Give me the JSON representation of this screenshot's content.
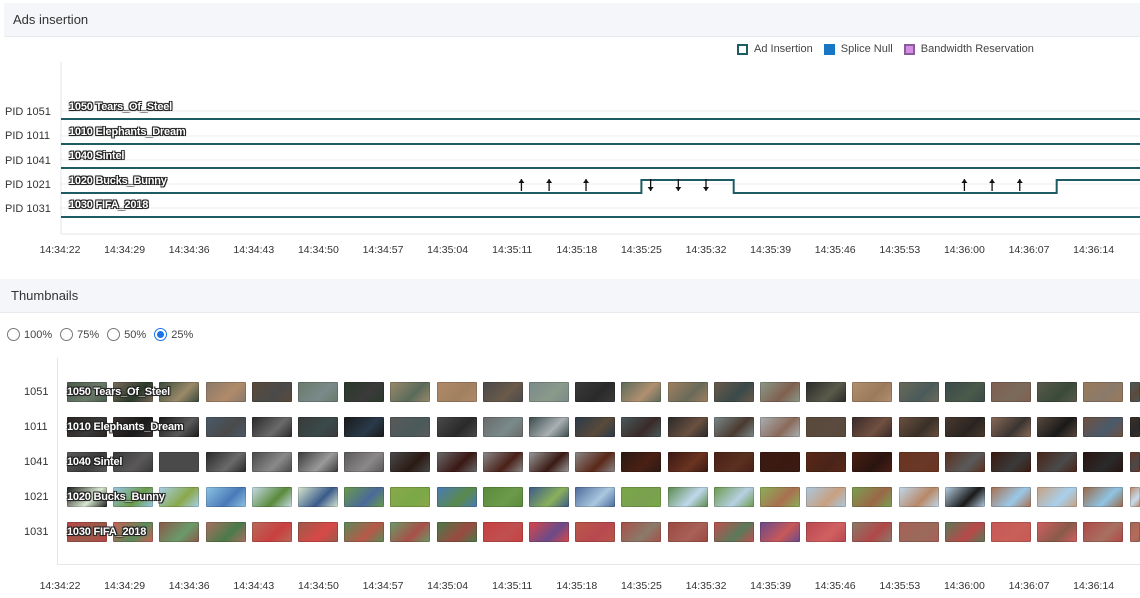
{
  "ads": {
    "title": "Ads insertion",
    "legend": [
      {
        "label": "Ad Insertion",
        "color": "#ffffff",
        "border": "#1d5c63"
      },
      {
        "label": "Splice Null",
        "color": "#1777c4",
        "border": "#1777c4"
      },
      {
        "label": "Bandwidth Reservation",
        "color": "#d48ee6",
        "border": "#8a5c99"
      }
    ],
    "line_color": "#1d5c63",
    "rows": [
      {
        "pid": "PID 1051",
        "stream": "1050 Tears_Of_Steel"
      },
      {
        "pid": "PID 1011",
        "stream": "1010 Elephants_Dream"
      },
      {
        "pid": "PID 1041",
        "stream": "1040 Sintel"
      },
      {
        "pid": "PID 1021",
        "stream": "1020 Bucks_Bunny"
      },
      {
        "pid": "PID 1031",
        "stream": "1030 FIFA_2018"
      }
    ],
    "events": {
      "up_arrows_1": [
        "14:35:12",
        "14:35:15",
        "14:35:19"
      ],
      "down_arrows": [
        "14:35:26",
        "14:35:29",
        "14:35:32"
      ],
      "up_arrows_2": [
        "14:36:00",
        "14:36:03",
        "14:36:06"
      ],
      "ad_block_1": {
        "start": "14:35:25",
        "end": "14:35:35"
      },
      "ad_block_2": {
        "start": "14:36:10",
        "end": "end"
      }
    },
    "time_ticks": [
      "14:34:22",
      "14:34:29",
      "14:34:36",
      "14:34:43",
      "14:34:50",
      "14:34:57",
      "14:35:04",
      "14:35:11",
      "14:35:18",
      "14:35:25",
      "14:35:32",
      "14:35:39",
      "14:35:46",
      "14:35:53",
      "14:36:00",
      "14:36:07",
      "14:36:14"
    ]
  },
  "thumbnails": {
    "title": "Thumbnails",
    "zoom_options": [
      {
        "label": "100%",
        "checked": false
      },
      {
        "label": "75%",
        "checked": false
      },
      {
        "label": "50%",
        "checked": false
      },
      {
        "label": "25%",
        "checked": true
      }
    ],
    "rows": [
      {
        "pid": "1051",
        "stream": "1050 Tears_Of_Steel",
        "palette": [
          "#4a5a4a",
          "#7a6a5a",
          "#3a4a3a",
          "#8a7a6a",
          "#5a4a3a",
          "#6a7a6a",
          "#2a3a2a",
          "#9a8a6a",
          "#b08a6a",
          "#4a4a4a",
          "#7a8a8a",
          "#3a3a3a",
          "#5a6a5a",
          "#a08060",
          "#6a5a4a",
          "#8a9a8a",
          "#2a2a2a",
          "#b09070",
          "#6a6a5a",
          "#3a4a4a",
          "#806050",
          "#5a5a4a",
          "#9a7a5a",
          "#4a5a5a"
        ]
      },
      {
        "pid": "1011",
        "stream": "1010 Elephants_Dream",
        "palette": [
          "#2a2420",
          "#3a3430",
          "#1a1a1a",
          "#4a5a6a",
          "#2a2a2a",
          "#3a3a3a",
          "#1a1a1a",
          "#5a5a5a",
          "#4a4a4a",
          "#6a6a6a",
          "#3a4a4a",
          "#2a3a4a",
          "#4a5a5a",
          "#2a2a2a",
          "#7a8a8a",
          "#aab0b4",
          "#5a4a3a",
          "#3a2a2a",
          "#6a5040",
          "#4a3a30",
          "#8a6a5a",
          "#5a4a40",
          "#705040",
          "#3a3028"
        ]
      },
      {
        "pid": "1041",
        "stream": "1040 Sintel",
        "palette": [
          "#5a5a5a",
          "#3a3a3a",
          "#4a4a4a",
          "#2a2a2a",
          "#4a4848",
          "#3a3a3a",
          "#5a5858",
          "#4a4a4a",
          "#6a6a6a",
          "#8a8a8a",
          "#9a9a9a",
          "#8a8888",
          "#2a1a14",
          "#3a1814",
          "#4a2018",
          "#3a1a14",
          "#5a2818",
          "#4a2014",
          "#6a3420",
          "#5a3020",
          "#3a1a10",
          "#4a2418",
          "#2a1410",
          "#6a3828"
        ]
      },
      {
        "pid": "1021",
        "stream": "1020 Bucks_Bunny",
        "palette": [
          "#1a1a1a",
          "#9ac8e8",
          "#a8d0ec",
          "#8ec4e4",
          "#c8dcec",
          "#d8e8d0",
          "#6a9a4a",
          "#8aa84a",
          "#4a7ab8",
          "#5a8a3a",
          "#3a5a8a",
          "#4a6a9a",
          "#7aa848",
          "#5a8a4a",
          "#6a9a4a",
          "#8ab05a",
          "#aac8e0",
          "#7aa050",
          "#c0d8ec",
          "#b8d0e4",
          "#a87050",
          "#c8a080",
          "#9a6848",
          "#b88868"
        ]
      },
      {
        "pid": "1031",
        "stream": "1030 FIFA_2018",
        "palette": [
          "#b84848",
          "#c86058",
          "#8a5a4a",
          "#a87060",
          "#b86a5a",
          "#9a5a4a",
          "#5a8a5a",
          "#6a9a6a",
          "#4a7a4a",
          "#c84040",
          "#d84848",
          "#b85848",
          "#a85048",
          "#9a4a40",
          "#c05050",
          "#6a4a8a",
          "#b84850",
          "#8a7a6a",
          "#a86058",
          "#5a7a5a",
          "#c85858",
          "#d06060",
          "#b04848",
          "#9a6a5a"
        ]
      }
    ],
    "time_ticks": [
      "14:34:22",
      "14:34:29",
      "14:34:36",
      "14:34:43",
      "14:34:50",
      "14:34:57",
      "14:35:04",
      "14:35:11",
      "14:35:18",
      "14:35:25",
      "14:35:32",
      "14:35:39",
      "14:35:46",
      "14:35:53",
      "14:36:00",
      "14:36:07",
      "14:36:14"
    ]
  }
}
